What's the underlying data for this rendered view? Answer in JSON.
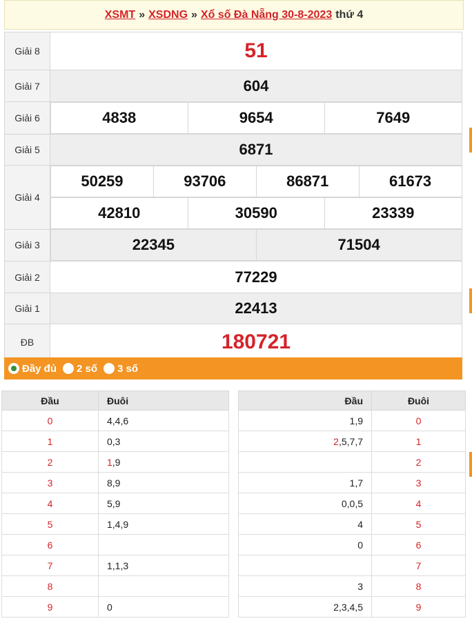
{
  "breadcrumb": {
    "link1": "XSMT",
    "link2": "XSDNG",
    "link3": "Xổ số Đà Nẵng 30-8-2023",
    "sep": "»",
    "weekday": "thứ 4"
  },
  "prizes": {
    "g8": {
      "label": "Giải 8",
      "numbers": [
        "51"
      ]
    },
    "g7": {
      "label": "Giải 7",
      "numbers": [
        "604"
      ]
    },
    "g6": {
      "label": "Giải 6",
      "numbers": [
        "4838",
        "9654",
        "7649"
      ]
    },
    "g5": {
      "label": "Giải 5",
      "numbers": [
        "6871"
      ]
    },
    "g4": {
      "label": "Giải 4",
      "numbers": [
        "50259",
        "93706",
        "86871",
        "61673",
        "42810",
        "30590",
        "23339"
      ]
    },
    "g3": {
      "label": "Giải 3",
      "numbers": [
        "22345",
        "71504"
      ]
    },
    "g2": {
      "label": "Giải 2",
      "numbers": [
        "77229"
      ]
    },
    "g1": {
      "label": "Giải 1",
      "numbers": [
        "22413"
      ]
    },
    "db": {
      "label": "ĐB",
      "numbers": [
        "180721"
      ]
    }
  },
  "options": {
    "full": "Đầy đủ",
    "two": "2 số",
    "three": "3 số",
    "selected": "full"
  },
  "loto_left": {
    "head_label": "Đầu",
    "tail_label": "Đuôi",
    "rows": [
      {
        "head": "0",
        "tail_red": "",
        "tail": "4,4,6"
      },
      {
        "head": "1",
        "tail_red": "",
        "tail": "0,3"
      },
      {
        "head": "2",
        "tail_red": "1",
        "tail": ",9"
      },
      {
        "head": "3",
        "tail_red": "",
        "tail": "8,9"
      },
      {
        "head": "4",
        "tail_red": "",
        "tail": "5,9"
      },
      {
        "head": "5",
        "tail_red": "",
        "tail": "1,4,9"
      },
      {
        "head": "6",
        "tail_red": "",
        "tail": ""
      },
      {
        "head": "7",
        "tail_red": "",
        "tail": "1,1,3"
      },
      {
        "head": "8",
        "tail_red": "",
        "tail": ""
      },
      {
        "head": "9",
        "tail_red": "",
        "tail": "0"
      }
    ]
  },
  "loto_right": {
    "head_label": "Đầu",
    "tail_label": "Đuôi",
    "rows": [
      {
        "head_red": "",
        "head": "1,9",
        "tail": "0"
      },
      {
        "head_red": "2",
        "head": ",5,7,7",
        "tail": "1"
      },
      {
        "head_red": "",
        "head": "",
        "tail": "2"
      },
      {
        "head_red": "",
        "head": "1,7",
        "tail": "3"
      },
      {
        "head_red": "",
        "head": "0,0,5",
        "tail": "4"
      },
      {
        "head_red": "",
        "head": "4",
        "tail": "5"
      },
      {
        "head_red": "",
        "head": "0",
        "tail": "6"
      },
      {
        "head_red": "",
        "head": "",
        "tail": "7"
      },
      {
        "head_red": "",
        "head": "3",
        "tail": "8"
      },
      {
        "head_red": "",
        "head": "2,3,4,5",
        "tail": "9"
      }
    ]
  },
  "colors": {
    "accent_red": "#d4232a",
    "orange": "#f39423",
    "radio_green": "#3c8d3c"
  }
}
